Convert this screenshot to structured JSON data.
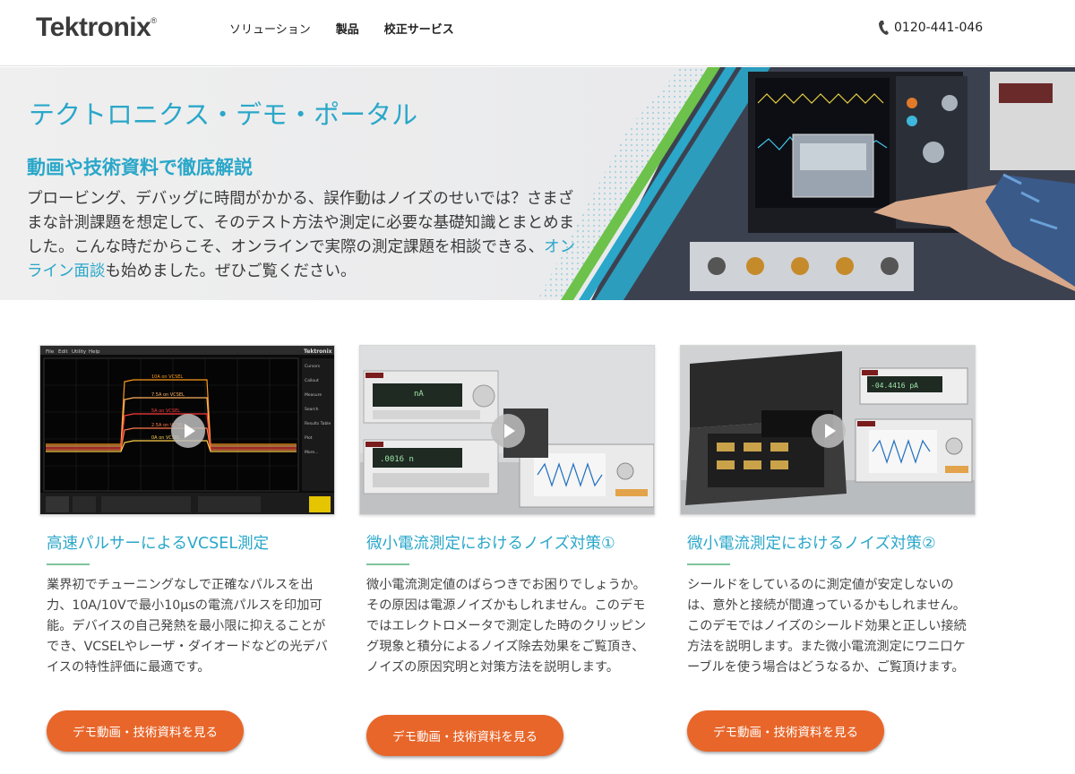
{
  "header": {
    "logo": "Tektronix",
    "logo_mark": "®",
    "nav": [
      "ソリューション",
      "製品",
      "校正サービス"
    ],
    "phone": "0120-441-046"
  },
  "hero": {
    "title": "テクトロニクス・デモ・ポータル",
    "subtitle": "動画や技術資料で徹底解説",
    "body_before": "プロービング、デバッグに時間がかかる、誤作動はノイズのせいでは？さまざまな計測課題を想定して、そのテスト方法や測定に必要な基礎知識とまとめました。こんな時だからこそ、オンラインで実際の測定課題を相談できる、",
    "body_link": "オンライン面談",
    "body_after": "も始めました。ぜひご覧ください。"
  },
  "cards": [
    {
      "title": "高速パルサーによるVCSEL測定",
      "description": "業界初でチューニングなしで正確なパルスを出力、10A/10Vで最小10μsの電流パルスを印加可能。デバイスの自己発熱を最小限に抑えることができ、VCSELやレーザ・ダイオードなどの光デバイスの特性評価に最適です。",
      "button": "デモ動画・技術資料を見る"
    },
    {
      "title": "微小電流測定におけるノイズ対策①",
      "description": "微小電流測定値のばらつきでお困りでしょうか。その原因は電源ノイズかもしれません。このデモではエレクトロメータで測定した時のクリッピング現象と積分によるノイズ除去効果をご覧頂き、ノイズの原因究明と対策方法を説明します。",
      "button": "デモ動画・技術資料を見る"
    },
    {
      "title": "微小電流測定におけるノイズ対策②",
      "description": "シールドをしているのに測定値が安定しないのは、意外と接続が間違っているかもしれません。このデモではノイズのシールド効果と正しい接続方法を説明します。また微小電流測定にワニ口ケーブルを使う場合はどうなるか、ご覧頂けます。",
      "button": "デモ動画・技術資料を見る"
    }
  ],
  "thumb1": {
    "menu": [
      "File",
      "Edit",
      "Utility",
      "Help"
    ],
    "brand": "Tektronix",
    "side_buttons": [
      "Cursors",
      "Callout",
      "Measure",
      "Search",
      "Results Table",
      "Plot",
      "More..."
    ],
    "traces": [
      "10A on VCSEL",
      "7.5A on VCSEL",
      "5A on VCSEL",
      "2.5A on VCSEL",
      "0A on VCSEL"
    ]
  },
  "thumb2": {
    "readout_top": "nA",
    "readout_bottom": ".0016 n"
  },
  "thumb3": {
    "readout": "-04.4416 pA"
  },
  "colors": {
    "accent": "#2aa7c9",
    "button": "#e8662a",
    "rule": "#7ec49b",
    "trace_colors": [
      "#ff9a1a",
      "#ffb060",
      "#ff3b3b",
      "#ff7a4a",
      "#ffd04a"
    ]
  }
}
